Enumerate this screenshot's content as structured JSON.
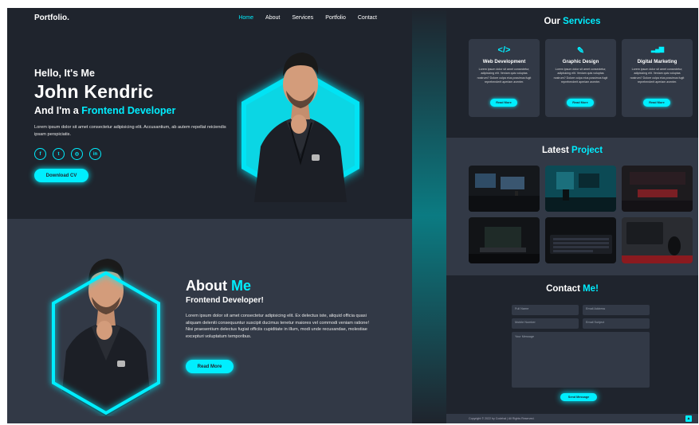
{
  "nav": {
    "logo": "Portfolio.",
    "items": [
      {
        "label": "Home",
        "active": true
      },
      {
        "label": "About",
        "active": false
      },
      {
        "label": "Services",
        "active": false
      },
      {
        "label": "Portfolio",
        "active": false
      },
      {
        "label": "Contact",
        "active": false
      }
    ]
  },
  "hero": {
    "greeting": "Hello, It's Me",
    "name": "John Kendric",
    "role_prefix": "And I'm a ",
    "role": "Frontend Developer",
    "description": "Lorem ipsum dolor sit amet consectetur adipisicing elit. Accusantium, ab autem repellat reiciendis ipsam perspiciatis.",
    "socials": [
      "facebook-icon",
      "twitter-icon",
      "instagram-icon",
      "linkedin-icon"
    ],
    "social_glyphs": [
      "f",
      "t",
      "◎",
      "in"
    ],
    "cta": "Download CV"
  },
  "about": {
    "title_prefix": "About ",
    "title_accent": "Me",
    "subtitle": "Frontend Developer!",
    "description": "Lorem ipsum dolor sit amet consectetur adipisicing elit. Ex delectus iste, aliquid officia quasi aliquam deleniti consequuntur suscipit ducimus tenetur maiores vel commodi veniam ratione! Nisi praesentium delectus fugiat officiis cupiditate in illum, modi unde recusandae, molestiae excepturi voluptatum temporibus.",
    "cta": "Read More"
  },
  "services": {
    "title_prefix": "Our ",
    "title_accent": "Services",
    "cards": [
      {
        "icon": "code-icon",
        "glyph": "</>",
        "title": "Web Development",
        "text": "Lorem ipsum dolor sit amet consectetur, adipisicing elit. Veniam quis voluptas nostrum? Dolore culpa eius possimus fugit reprehenderit aperiam aventer.",
        "cta": "Read More"
      },
      {
        "icon": "pen-brush-icon",
        "glyph": "✎",
        "title": "Graphic Design",
        "text": "Lorem ipsum dolor sit amet consectetur, adipisicing elit. Veniam quis voluptas nostrum? Dolore culpa eius possimus fugit reprehenderit aperiam aventer.",
        "cta": "Read More"
      },
      {
        "icon": "bar-chart-icon",
        "glyph": "▂▄▆",
        "title": "Digital Marketing",
        "text": "Lorem ipsum dolor sit amet consectetur, adipisicing elit. Veniam quis voluptas nostrum? Dolore culpa eius possimus fugit reprehenderit aperiam aventer.",
        "cta": "Read More"
      }
    ]
  },
  "projects": {
    "title_prefix": "Latest ",
    "title_accent": "Project"
  },
  "contact": {
    "title_prefix": "Contact ",
    "title_accent": "Me!",
    "fields": {
      "full_name": "Full Name",
      "email": "Email Address",
      "mobile": "Mobile Number",
      "subject": "Email Subject",
      "message": "Your Message"
    },
    "submit": "Send Message"
  },
  "footer": {
    "copyright": "Copyright © 2022 by Codehal | All Rights Reserved.",
    "up_glyph": "▲"
  },
  "colors": {
    "background": "#1f242d",
    "second_bg": "#323946",
    "accent": "#00eeff"
  }
}
